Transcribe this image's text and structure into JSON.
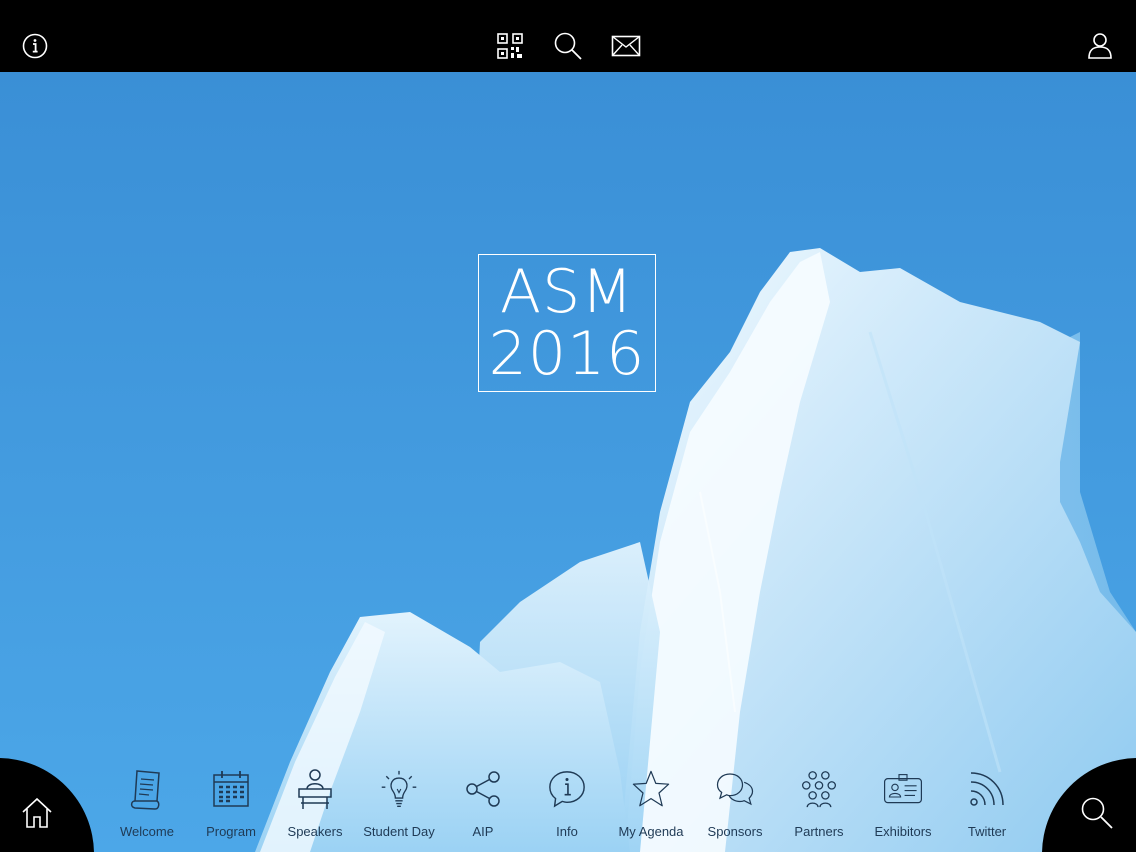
{
  "logo": {
    "line1": "ASM",
    "line2": "2016"
  },
  "topbar": {
    "info_icon": "info-icon",
    "qr_icon": "qr-code-icon",
    "search_icon": "search-icon",
    "mail_icon": "mail-icon",
    "profile_icon": "user-icon"
  },
  "corners": {
    "left_icon": "home-icon",
    "right_icon": "search-icon"
  },
  "nav": {
    "items": [
      {
        "label": "Welcome",
        "icon": "scroll-icon"
      },
      {
        "label": "Program",
        "icon": "calendar-icon"
      },
      {
        "label": "Speakers",
        "icon": "podium-speaker-icon"
      },
      {
        "label": "Student Day",
        "icon": "lightbulb-icon"
      },
      {
        "label": "AIP",
        "icon": "share-icon"
      },
      {
        "label": "Info",
        "icon": "info-bubble-icon"
      },
      {
        "label": "My Agenda",
        "icon": "star-icon"
      },
      {
        "label": "Sponsors",
        "icon": "chat-bubbles-icon"
      },
      {
        "label": "Partners",
        "icon": "group-icon"
      },
      {
        "label": "Exhibitors",
        "icon": "id-badge-icon"
      },
      {
        "label": "Twitter",
        "icon": "rss-feed-icon"
      }
    ]
  },
  "colors": {
    "sky_top": "#3a8fd6",
    "sky_bottom": "#4ca7e8",
    "bar": "#000000",
    "nav_text": "#1f3a55",
    "ice_light": "#eaf6fd",
    "ice_mid": "#a9d6f3"
  }
}
